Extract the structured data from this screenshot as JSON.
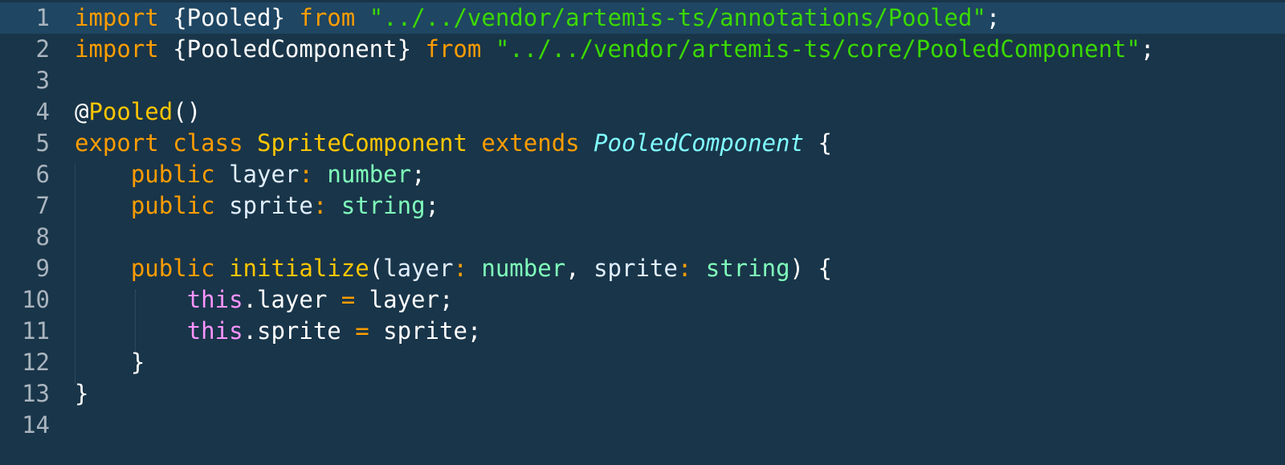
{
  "editor": {
    "colors": {
      "background": "#193549",
      "current_line": "#1f4662",
      "keyword": "#ff9d00",
      "string": "#3ad900",
      "class_name": "#ffc600",
      "type": "#80ffbb",
      "inherited": "#80fcff",
      "this": "#fb94ff",
      "line_number": "#aab4be"
    },
    "lines": [
      {
        "num": "1",
        "tokens": [
          {
            "t": "import",
            "c": "kw"
          },
          {
            "t": " {Pooled} ",
            "c": "punc"
          },
          {
            "t": "from",
            "c": "kw"
          },
          {
            "t": " ",
            "c": "punc"
          },
          {
            "t": "\"../../vendor/artemis-ts/annotations/Pooled\"",
            "c": "str"
          },
          {
            "t": ";",
            "c": "punc"
          }
        ]
      },
      {
        "num": "2",
        "tokens": [
          {
            "t": "import",
            "c": "kw"
          },
          {
            "t": " {PooledComponent} ",
            "c": "punc"
          },
          {
            "t": "from",
            "c": "kw"
          },
          {
            "t": " ",
            "c": "punc"
          },
          {
            "t": "\"../../vendor/artemis-ts/core/PooledComponent\"",
            "c": "str"
          },
          {
            "t": ";",
            "c": "punc"
          }
        ]
      },
      {
        "num": "3",
        "tokens": []
      },
      {
        "num": "4",
        "tokens": [
          {
            "t": "@",
            "c": "punc"
          },
          {
            "t": "Pooled",
            "c": "deco"
          },
          {
            "t": "()",
            "c": "punc"
          }
        ]
      },
      {
        "num": "5",
        "tokens": [
          {
            "t": "export",
            "c": "kw"
          },
          {
            "t": " ",
            "c": "punc"
          },
          {
            "t": "class",
            "c": "kw"
          },
          {
            "t": " ",
            "c": "punc"
          },
          {
            "t": "SpriteComponent",
            "c": "cls"
          },
          {
            "t": " ",
            "c": "punc"
          },
          {
            "t": "extends",
            "c": "kw"
          },
          {
            "t": " ",
            "c": "punc"
          },
          {
            "t": "PooledComponent",
            "c": "inherit"
          },
          {
            "t": " {",
            "c": "punc"
          }
        ]
      },
      {
        "num": "6",
        "tokens": [
          {
            "t": "    ",
            "c": "punc"
          },
          {
            "t": "public",
            "c": "kw"
          },
          {
            "t": " ",
            "c": "punc"
          },
          {
            "t": "layer",
            "c": "ident"
          },
          {
            "t": ": ",
            "c": "kw"
          },
          {
            "t": "number",
            "c": "type"
          },
          {
            "t": ";",
            "c": "punc"
          }
        ]
      },
      {
        "num": "7",
        "tokens": [
          {
            "t": "    ",
            "c": "punc"
          },
          {
            "t": "public",
            "c": "kw"
          },
          {
            "t": " ",
            "c": "punc"
          },
          {
            "t": "sprite",
            "c": "ident"
          },
          {
            "t": ": ",
            "c": "kw"
          },
          {
            "t": "string",
            "c": "type"
          },
          {
            "t": ";",
            "c": "punc"
          }
        ]
      },
      {
        "num": "8",
        "tokens": []
      },
      {
        "num": "9",
        "tokens": [
          {
            "t": "    ",
            "c": "punc"
          },
          {
            "t": "public",
            "c": "kw"
          },
          {
            "t": " ",
            "c": "punc"
          },
          {
            "t": "initialize",
            "c": "cls"
          },
          {
            "t": "(",
            "c": "punc"
          },
          {
            "t": "layer",
            "c": "ident"
          },
          {
            "t": ": ",
            "c": "kw"
          },
          {
            "t": "number",
            "c": "type"
          },
          {
            "t": ", ",
            "c": "punc"
          },
          {
            "t": "sprite",
            "c": "ident"
          },
          {
            "t": ": ",
            "c": "kw"
          },
          {
            "t": "string",
            "c": "type"
          },
          {
            "t": ") {",
            "c": "punc"
          }
        ]
      },
      {
        "num": "10",
        "tokens": [
          {
            "t": "        ",
            "c": "punc"
          },
          {
            "t": "this",
            "c": "this"
          },
          {
            "t": ".layer ",
            "c": "punc"
          },
          {
            "t": "=",
            "c": "kw"
          },
          {
            "t": " layer;",
            "c": "punc"
          }
        ]
      },
      {
        "num": "11",
        "tokens": [
          {
            "t": "        ",
            "c": "punc"
          },
          {
            "t": "this",
            "c": "this"
          },
          {
            "t": ".sprite ",
            "c": "punc"
          },
          {
            "t": "=",
            "c": "kw"
          },
          {
            "t": " sprite;",
            "c": "punc"
          }
        ]
      },
      {
        "num": "12",
        "tokens": [
          {
            "t": "    }",
            "c": "punc"
          }
        ]
      },
      {
        "num": "13",
        "tokens": [
          {
            "t": "}",
            "c": "punc"
          }
        ]
      },
      {
        "num": "14",
        "tokens": []
      }
    ]
  }
}
